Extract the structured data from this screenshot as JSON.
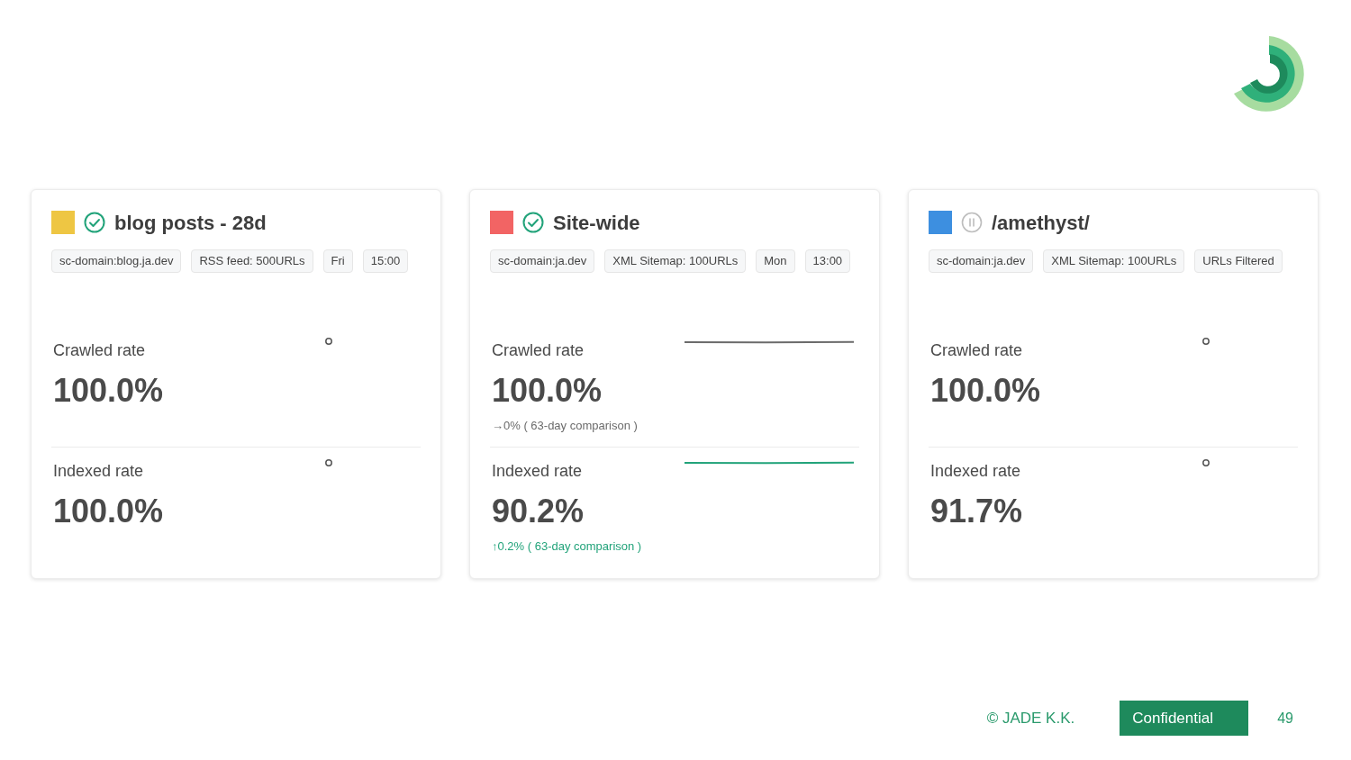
{
  "cards": [
    {
      "color": "#eec643",
      "paused": false,
      "title": "blog posts - 28d",
      "tags": [
        "sc-domain:blog.ja.dev",
        "RSS feed: 500URLs",
        "Fri",
        "15:00"
      ],
      "metrics": [
        {
          "label": "Crawled rate",
          "value": "100.0%",
          "kind": "dot"
        },
        {
          "label": "Indexed rate",
          "value": "100.0%",
          "kind": "dot"
        }
      ]
    },
    {
      "color": "#f26464",
      "paused": false,
      "title": "Site-wide",
      "tags": [
        "sc-domain:ja.dev",
        "XML Sitemap: 100URLs",
        "Mon",
        "13:00"
      ],
      "metrics": [
        {
          "label": "Crawled rate",
          "value": "100.0%",
          "kind": "sparkline",
          "rising": false,
          "comparison": "→0% ( 63-day comparison )"
        },
        {
          "label": "Indexed rate",
          "value": "90.2%",
          "kind": "sparkline",
          "rising": true,
          "comparison": "↑0.2% ( 63-day comparison )"
        }
      ]
    },
    {
      "color": "#3d8fe0",
      "paused": true,
      "title": "/amethyst/",
      "tags": [
        "sc-domain:ja.dev",
        "XML Sitemap: 100URLs",
        "URLs Filtered"
      ],
      "metrics": [
        {
          "label": "Crawled rate",
          "value": "100.0%",
          "kind": "dot"
        },
        {
          "label": "Indexed rate",
          "value": "91.7%",
          "kind": "dot"
        }
      ]
    }
  ],
  "footer": {
    "copyright": "© JADE K.K.",
    "badge": "Confidential",
    "page": "49"
  }
}
